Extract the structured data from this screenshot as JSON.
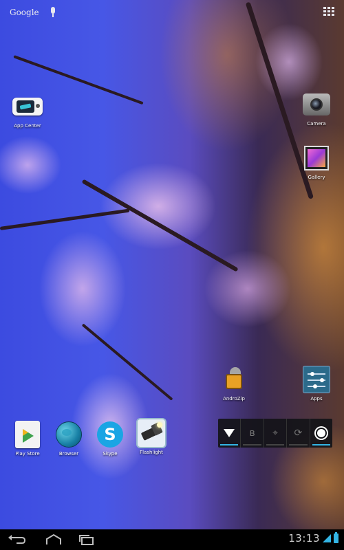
{
  "search_bar": {
    "logo_text": "Google",
    "icons": [
      "mic-icon"
    ]
  },
  "top_right": {
    "icon": "all-apps-grid-icon"
  },
  "apps": {
    "app_center": {
      "label": "App Center",
      "icon": "app-center-icon"
    },
    "camera": {
      "label": "Camera",
      "icon": "camera-icon"
    },
    "gallery": {
      "label": "Gallery",
      "icon": "gallery-icon"
    },
    "androzip": {
      "label": "AndroZip",
      "icon": "androzip-icon"
    },
    "apps_settings": {
      "label": "Apps",
      "icon": "sliders-icon"
    },
    "play_store": {
      "label": "Play Store",
      "icon": "play-store-icon"
    },
    "browser": {
      "label": "Browser",
      "icon": "globe-icon"
    },
    "skype": {
      "label": "Skype",
      "icon": "skype-icon",
      "glyph": "S"
    },
    "flashlight": {
      "label": "Flashlight",
      "icon": "flashlight-icon"
    }
  },
  "power_widget": {
    "toggles": [
      {
        "name": "wifi",
        "icon": "wifi-icon",
        "state": "on"
      },
      {
        "name": "bluetooth",
        "icon": "bluetooth-icon",
        "glyph": "ʙ",
        "state": "off"
      },
      {
        "name": "gps",
        "icon": "gps-icon",
        "glyph": "⌖",
        "state": "off"
      },
      {
        "name": "sync",
        "icon": "sync-icon",
        "glyph": "⟳",
        "state": "off"
      },
      {
        "name": "brightness",
        "icon": "brightness-icon",
        "state": "on"
      }
    ],
    "accent_color": "#33b5e5"
  },
  "navigation_bar": {
    "buttons": [
      "back-icon",
      "home-icon",
      "recent-apps-icon"
    ],
    "clock": "13:13",
    "status_icons": [
      "signal-icon",
      "battery-icon"
    ],
    "accent_color": "#33b5e5"
  }
}
